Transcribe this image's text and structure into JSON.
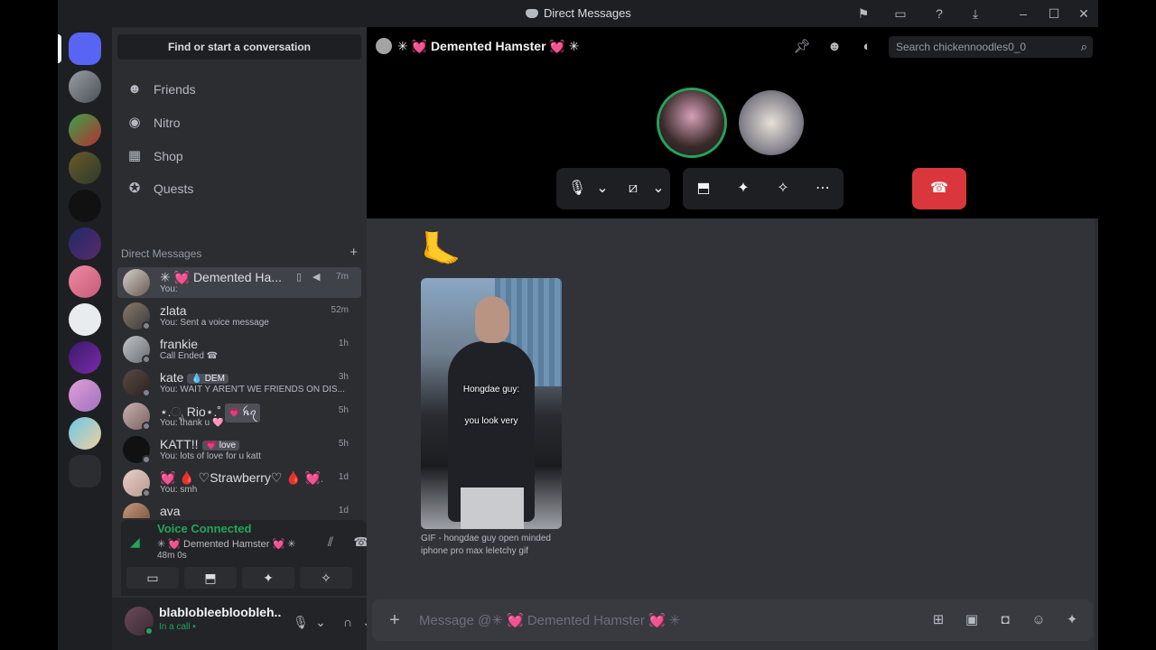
{
  "window": {
    "title": "Direct Messages"
  },
  "sidebar": {
    "find_label": "Find or start a conversation",
    "nav": [
      {
        "label": "Friends",
        "icon": "friends-icon"
      },
      {
        "label": "Nitro",
        "icon": "nitro-icon"
      },
      {
        "label": "Shop",
        "icon": "shop-icon"
      },
      {
        "label": "Quests",
        "icon": "quests-icon"
      }
    ],
    "dm_header": "Direct Messages",
    "dms": [
      {
        "name": "✳ 💓 Demented Ha...",
        "sub": "You:",
        "time": "7m",
        "active": true
      },
      {
        "name": "zlata",
        "sub": "You: Sent a voice message",
        "time": "52m"
      },
      {
        "name": "frankie",
        "sub": "Call Ended ☎",
        "time": "1h"
      },
      {
        "name": "kate",
        "badge": "💧 DEM",
        "sub": "You: WAIT Y AREN'T WE FRIENDS ON DIS...",
        "time": "3h"
      },
      {
        "name": "⋆.ೃ Rio⋆.˚",
        "badge": "💗 ꫝꪖ",
        "sub": "You: thank u 🩷",
        "time": "5h"
      },
      {
        "name": "KATT!!",
        "badge": "💗 love",
        "sub": "You: lots of love for u katt",
        "time": "5h"
      },
      {
        "name": "💓 🩸 ♡Strawberry♡ 🩸 💓...",
        "sub": "You: smh",
        "time": "1d"
      },
      {
        "name": "ava",
        "sub": "",
        "time": "1d"
      }
    ]
  },
  "voice": {
    "status": "Voice Connected",
    "channel": "✳ 💓 Demented Hamster 💓 ✳",
    "timer": "48m 0s"
  },
  "user": {
    "name": "blablobleebloobleh...",
    "status": "In a call •"
  },
  "channel": {
    "title": "✳ 💓 Demented Hamster 💓 ✳",
    "search_placeholder": "Search chickennoodles0_0"
  },
  "messages": {
    "emoji": "🦶",
    "gif_caption_1": "Hongdae guy:",
    "gif_caption_2": "you look very",
    "gif_title": "GIF - hongdae guy open minded iphone pro max leletchy gif"
  },
  "composer": {
    "placeholder": "Message @✳ 💓 Demented Hamster 💓 ✳"
  },
  "colors": {
    "accent_green": "#23a55a",
    "hangup_red": "#da373c",
    "bg_main": "#313338",
    "bg_sidebar": "#2b2d31"
  }
}
